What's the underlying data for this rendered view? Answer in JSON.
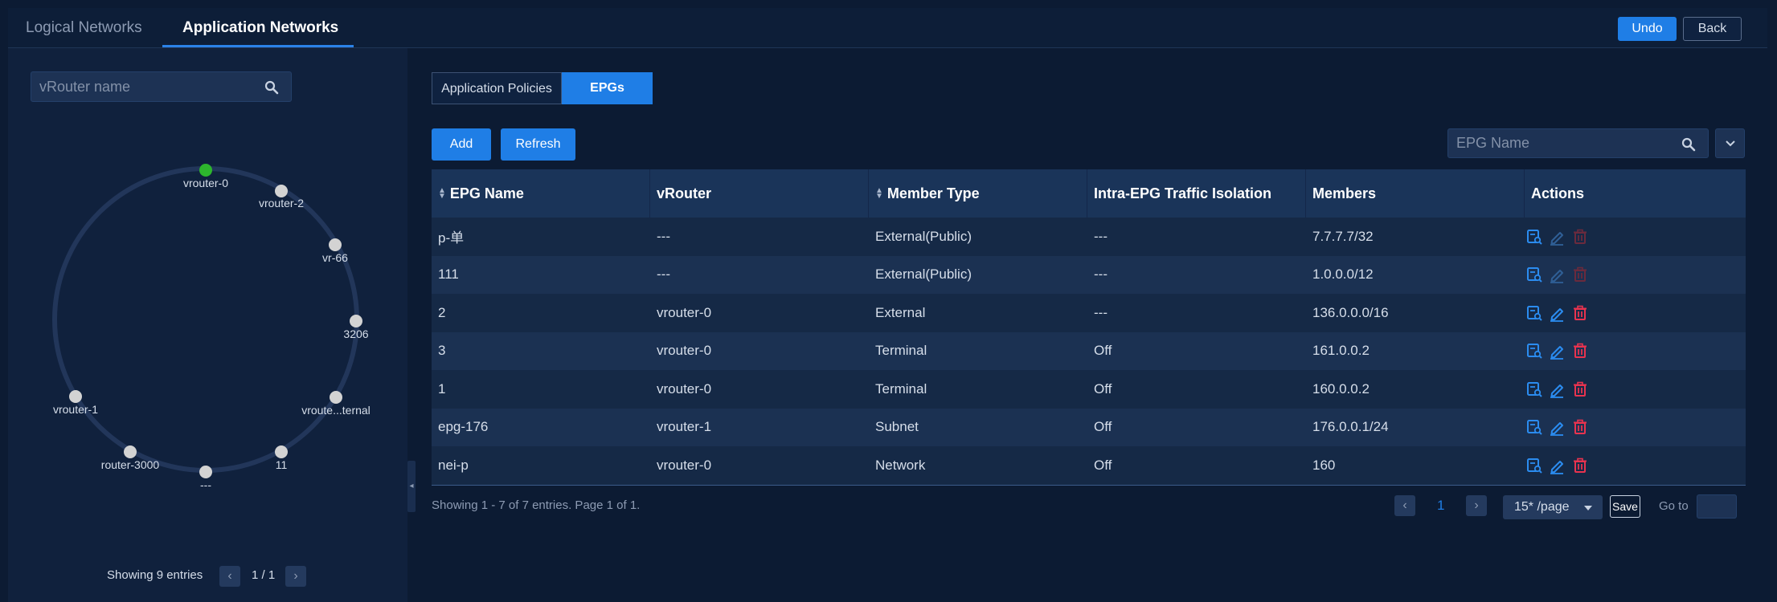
{
  "top_tabs": [
    {
      "label": "Logical Networks",
      "active": false
    },
    {
      "label": "Application Networks",
      "active": true
    }
  ],
  "header_buttons": {
    "undo": "Undo",
    "back": "Back"
  },
  "left": {
    "search_placeholder": "vRouter name",
    "nodes": [
      {
        "label": "vrouter-0",
        "color": "#2db52d"
      },
      {
        "label": "vrouter-2",
        "color": "#d3d3d3"
      },
      {
        "label": "vr-66",
        "color": "#d3d3d3"
      },
      {
        "label": "3206",
        "color": "#d3d3d3"
      },
      {
        "label": "vroute...ternal",
        "color": "#d3d3d3"
      },
      {
        "label": "11",
        "color": "#d3d3d3"
      },
      {
        "label": "---",
        "color": "#d3d3d3"
      },
      {
        "label": "router-3000",
        "color": "#d3d3d3"
      },
      {
        "label": "vrouter-1",
        "color": "#d3d3d3"
      }
    ],
    "footer": {
      "text": "Showing 9 entries",
      "page": "1 / 1"
    }
  },
  "sub_tabs": [
    {
      "label": "Application Policies",
      "active": false
    },
    {
      "label": "EPGs",
      "active": true
    }
  ],
  "toolbar": {
    "add": "Add",
    "refresh": "Refresh",
    "search_placeholder": "EPG Name"
  },
  "table": {
    "columns": [
      {
        "label": "EPG Name",
        "sortable": true
      },
      {
        "label": "vRouter",
        "sortable": false
      },
      {
        "label": "Member Type",
        "sortable": true
      },
      {
        "label": "Intra-EPG Traffic Isolation",
        "sortable": false
      },
      {
        "label": "Members",
        "sortable": false
      },
      {
        "label": "Actions",
        "sortable": false
      }
    ],
    "rows": [
      {
        "name": "p-单",
        "vrouter": "---",
        "member_type": "External(Public)",
        "isolation": "---",
        "members": "7.7.7.7/32",
        "actions_enabled": false
      },
      {
        "name": "111",
        "vrouter": "---",
        "member_type": "External(Public)",
        "isolation": "---",
        "members": "1.0.0.0/12",
        "actions_enabled": false
      },
      {
        "name": "2",
        "vrouter": "vrouter-0",
        "member_type": "External",
        "isolation": "---",
        "members": "136.0.0.0/16",
        "actions_enabled": true
      },
      {
        "name": "3",
        "vrouter": "vrouter-0",
        "member_type": "Terminal",
        "isolation": "Off",
        "members": "161.0.0.2",
        "actions_enabled": true
      },
      {
        "name": "1",
        "vrouter": "vrouter-0",
        "member_type": "Terminal",
        "isolation": "Off",
        "members": "160.0.0.2",
        "actions_enabled": true
      },
      {
        "name": "epg-176",
        "vrouter": "vrouter-1",
        "member_type": "Subnet",
        "isolation": "Off",
        "members": "176.0.0.1/24",
        "actions_enabled": true
      },
      {
        "name": "nei-p",
        "vrouter": "vrouter-0",
        "member_type": "Network",
        "isolation": "Off",
        "members": "160",
        "actions_enabled": true
      }
    ]
  },
  "pagination": {
    "summary": "Showing 1 - 7 of 7 entries. Page 1 of 1.",
    "current_page": "1",
    "page_size": "15* /page",
    "save": "Save",
    "goto": "Go to"
  },
  "colors": {
    "accent": "#1f7ee6",
    "danger": "#e8334f",
    "node_active": "#2db52d"
  }
}
